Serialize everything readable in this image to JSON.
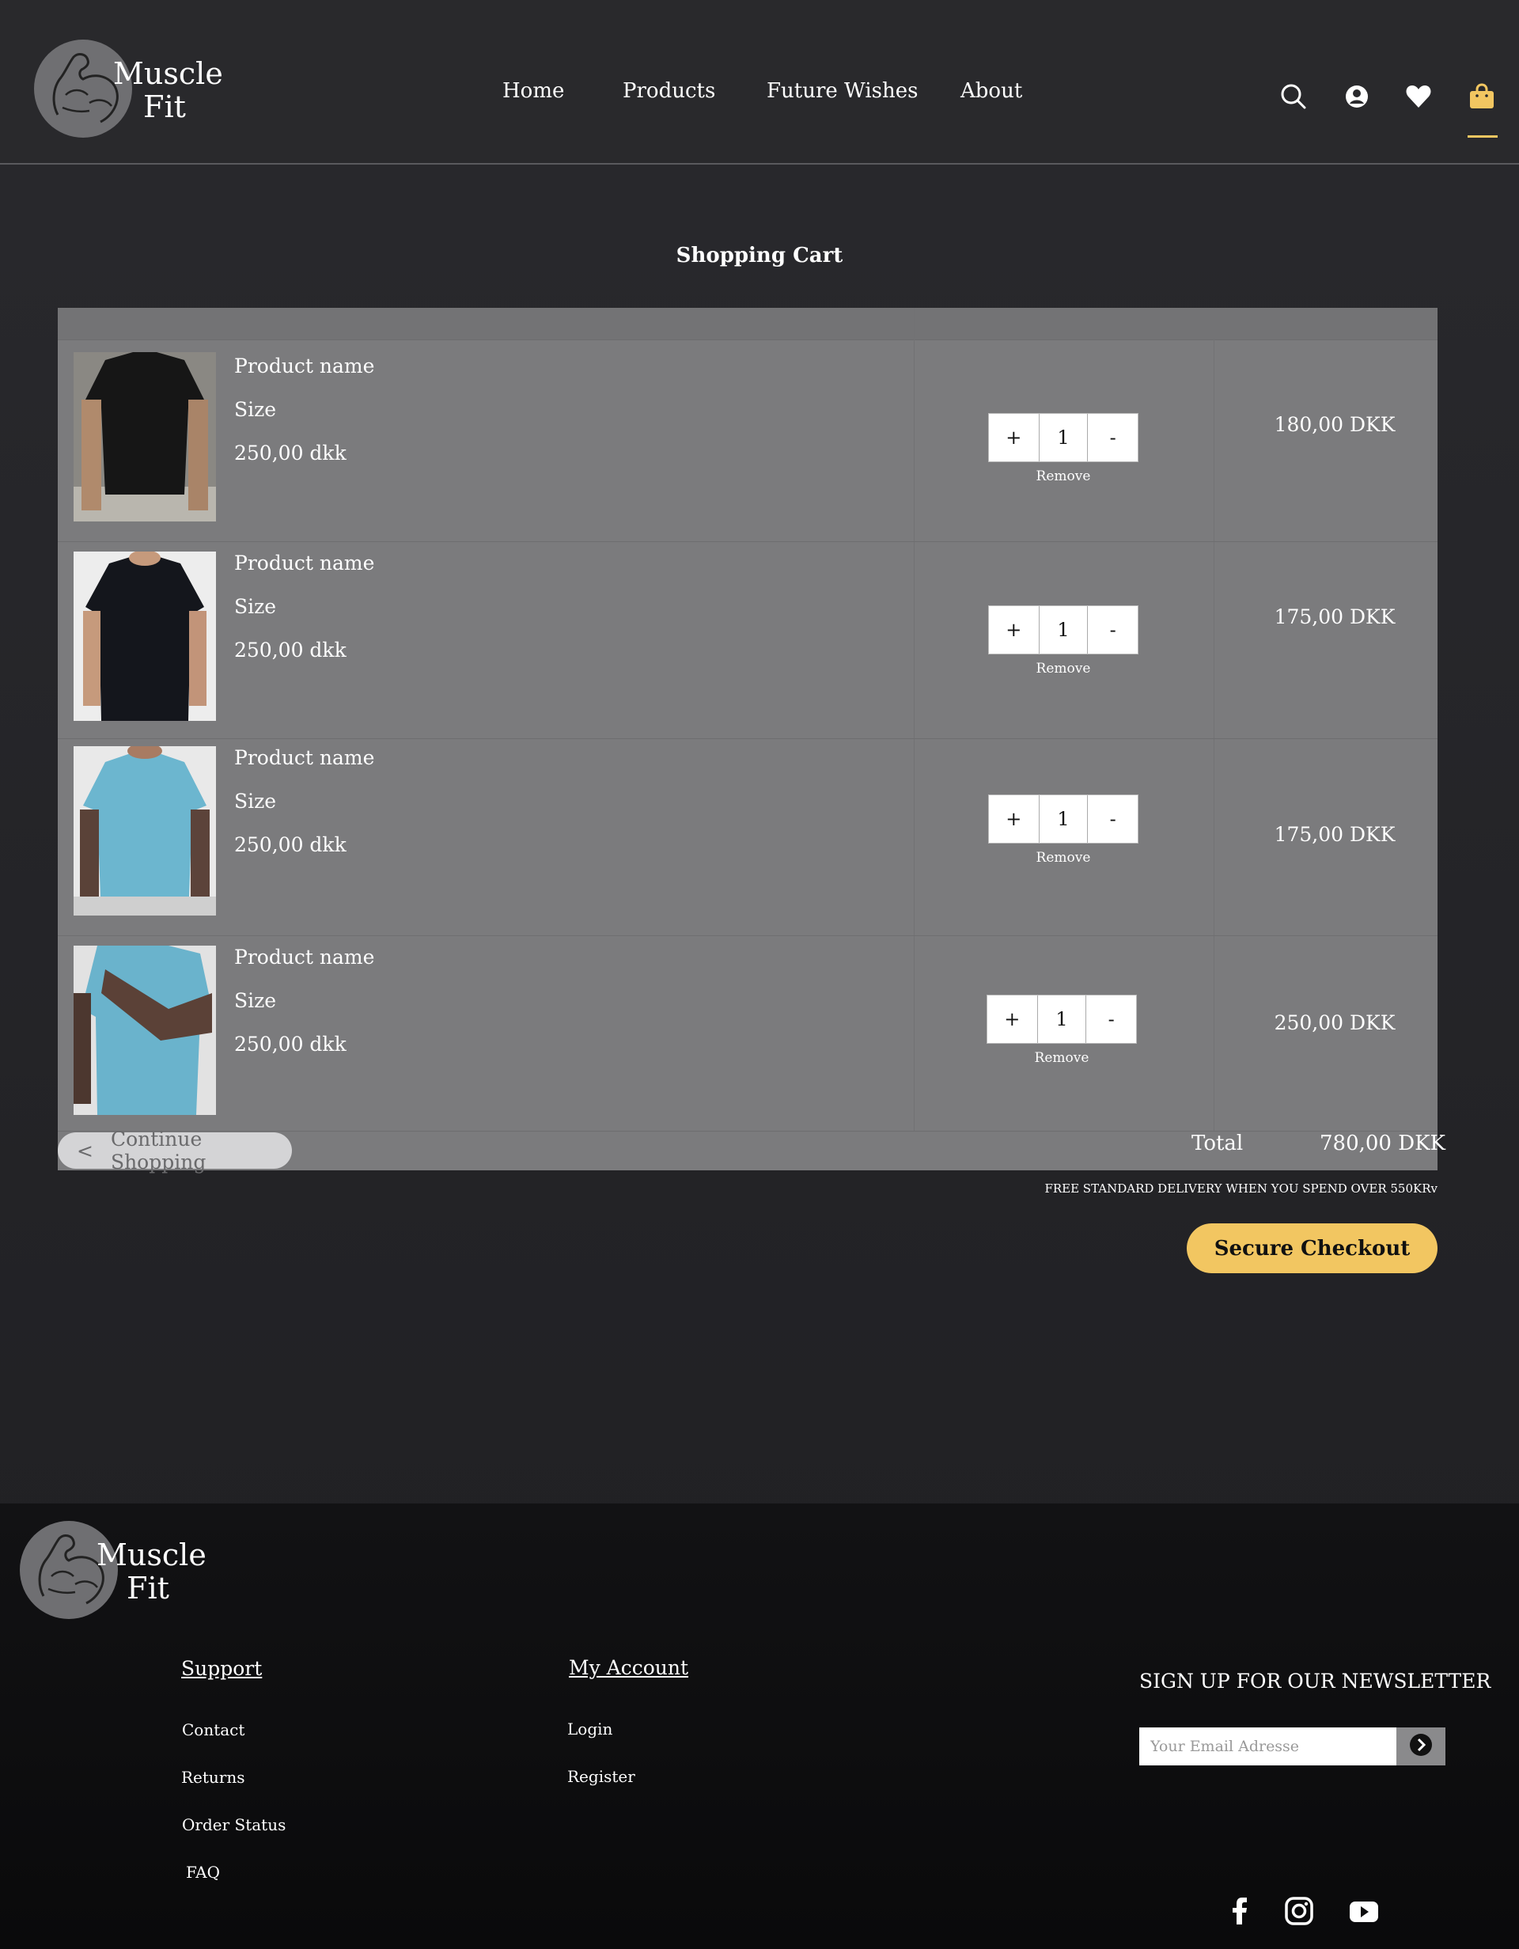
{
  "brand": {
    "line1": "Muscle",
    "line2": "Fit"
  },
  "nav": {
    "home": "Home",
    "products": "Products",
    "future_wishes": "Future Wishes",
    "about": "About"
  },
  "header_icons": [
    "search-icon",
    "user-icon",
    "heart-icon",
    "shopping-bag-icon"
  ],
  "colors": {
    "accent": "#f2c661",
    "background": "#29292c",
    "table": "#7b7b7d",
    "footer": "#0f0f11"
  },
  "cart": {
    "title": "Shopping Cart",
    "items": [
      {
        "name": "Product name",
        "size": "Size",
        "price": "250,00 dkk",
        "qty": "1",
        "plus": "+",
        "minus": "-",
        "remove": "Remove",
        "total": "180,00 DKK"
      },
      {
        "name": "Product name",
        "size": "Size",
        "price": "250,00 dkk",
        "qty": "1",
        "plus": "+",
        "minus": "-",
        "remove": "Remove",
        "total": "175,00 DKK"
      },
      {
        "name": "Product name",
        "size": "Size",
        "price": "250,00 dkk",
        "qty": "1",
        "plus": "+",
        "minus": "-",
        "remove": "Remove",
        "total": "175,00 DKK"
      },
      {
        "name": "Product name",
        "size": "Size",
        "price": "250,00 dkk",
        "qty": "1",
        "plus": "+",
        "minus": "-",
        "remove": "Remove",
        "total": "250,00 DKK"
      }
    ],
    "continue_chevron": "<",
    "continue_label": "Continue Shopping",
    "total_label": "Total",
    "total_value": "780,00 DKK",
    "free_delivery": "FREE STANDARD DELIVERY WHEN YOU SPEND OVER 550KRv",
    "checkout_label": "Secure Checkout"
  },
  "footer": {
    "support": {
      "heading": "Support",
      "links": [
        "Contact",
        "Returns",
        "Order Status",
        "FAQ"
      ]
    },
    "account": {
      "heading": "My Account",
      "links": [
        "Login",
        "Register"
      ]
    },
    "newsletter": {
      "title": "SIGN UP FOR OUR NEWSLETTER",
      "placeholder": "Your Email Adresse"
    },
    "social": [
      "facebook-icon",
      "instagram-icon",
      "youtube-icon"
    ]
  }
}
